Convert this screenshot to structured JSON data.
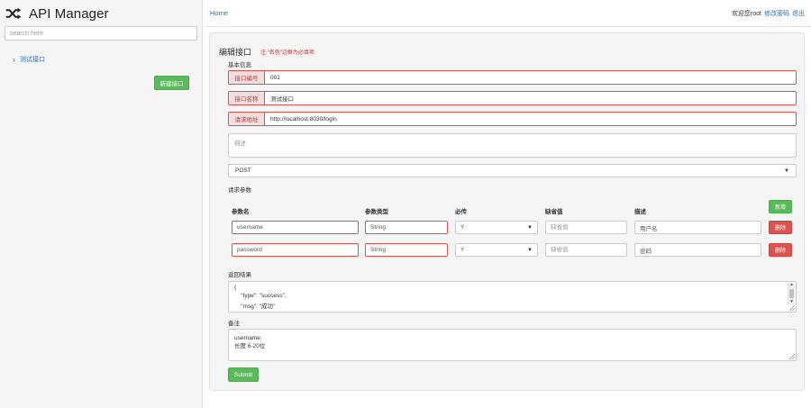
{
  "sidebar": {
    "brand_title": "API Manager",
    "brand_icon": "shuffle-icon",
    "search_placeholder": "search here",
    "tree_items": [
      {
        "label": "测试接口",
        "icon": "chevron-right-icon"
      }
    ],
    "new_api_button": "新建接口"
  },
  "topbar": {
    "home": "Home",
    "welcome": "欢迎您root",
    "change_password": "修改密码",
    "logout": "退出"
  },
  "form": {
    "title": "编辑接口",
    "hint": "注:\"名色\"边框为必填项",
    "basic_info_label": "基本信息",
    "api_no_label": "接口编号",
    "api_no_value": "001",
    "api_name_label": "接口名称",
    "api_name_value": "测试接口",
    "url_label": "请求地址",
    "url_value": "http://localhost:8030/login",
    "description_placeholder": "描述",
    "method": "POST",
    "params_label": "请求参数",
    "params_headers": [
      "参数名",
      "参数类型",
      "必传",
      "缺省值",
      "描述"
    ],
    "add_button": "新增",
    "default_placeholder": "缺省值",
    "params": [
      {
        "name": "username",
        "type": "String",
        "required": "Y",
        "default": "",
        "description": "用户名",
        "delete_label": "删除"
      },
      {
        "name": "password",
        "type": "String",
        "required": "Y",
        "default": "",
        "description": "密码",
        "delete_label": "删除"
      }
    ],
    "result_label": "返回结果",
    "result_lines": [
      "{",
      "    \"type\": \"success\",",
      "    \"msg\": \"成功\""
    ],
    "notes_label": "备注",
    "notes_lines": [
      "username:",
      "长度 6-20位"
    ],
    "submit_button": "Submit"
  },
  "colors": {
    "brand_green": "#5cb85c",
    "danger_red": "#d9534f",
    "link_blue": "#2a6db5",
    "addon_bg": "#f2dede"
  }
}
